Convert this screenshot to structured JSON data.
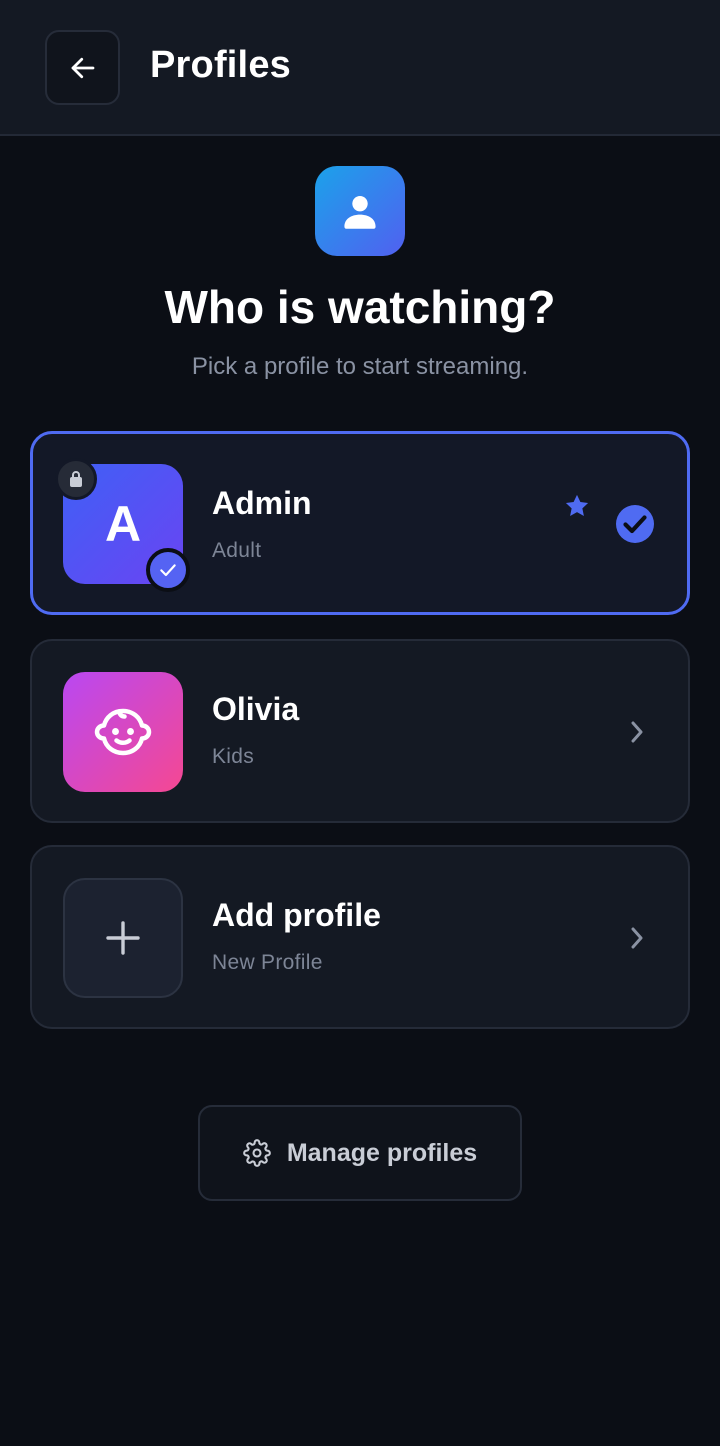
{
  "header": {
    "title": "Profiles",
    "back_icon": "arrow-left-icon"
  },
  "hero": {
    "icon": "user-icon",
    "title": "Who is watching?",
    "subtitle": "Pick a profile to start streaming."
  },
  "profiles": [
    {
      "name": "Admin",
      "type": "Adult",
      "avatar_letter": "A",
      "selected": true,
      "locked": true,
      "favorite": true,
      "accent": "#4f6bf2"
    },
    {
      "name": "Olivia",
      "type": "Kids",
      "avatar_icon": "baby-face-icon",
      "selected": false
    },
    {
      "name": "Add profile",
      "type": "New Profile",
      "avatar_icon": "plus-icon",
      "selected": false
    }
  ],
  "footer": {
    "manage_label": "Manage profiles",
    "manage_icon": "gear-icon"
  },
  "colors": {
    "background": "#0b0e15",
    "card": "#141923",
    "accent": "#4f6bf2",
    "hero_gradient_start": "#1ba2ea",
    "hero_gradient_end": "#5160f0",
    "kids_gradient_start": "#b948f2",
    "kids_gradient_end": "#f54892"
  }
}
